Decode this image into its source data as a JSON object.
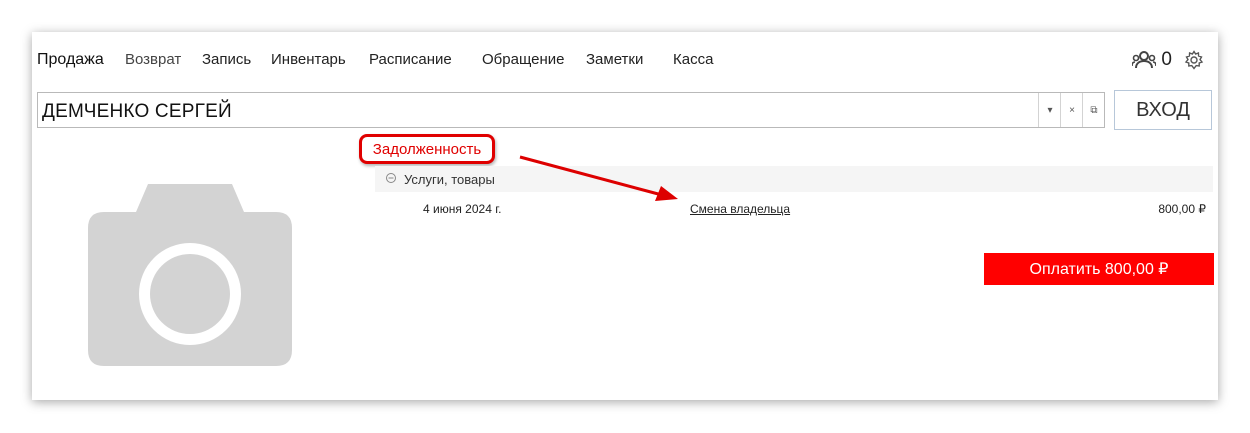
{
  "menu": {
    "items": [
      "Продажа",
      "Возврат",
      "Запись",
      "Инвентарь",
      "Расписание",
      "Обращение",
      "Заметки",
      "Касса"
    ]
  },
  "header": {
    "users_count": "0",
    "users_icon": "users-icon",
    "settings_icon": "gear-icon"
  },
  "client": {
    "name": "ДЕМЧЕНКО СЕРГЕЙ",
    "dropdown_glyph": "▾",
    "clear_glyph": "×",
    "open_glyph": "⧉"
  },
  "login_button": "ВХОД",
  "debt": {
    "label": "Задолженность",
    "group": {
      "label": "Услуги, товары",
      "collapse_glyph": "⊖"
    },
    "items": [
      {
        "date": "4 июня 2024 г.",
        "name": "Смена владельца",
        "amount": "800,00 ₽"
      }
    ]
  },
  "pay_button": "Оплатить 800,00 ₽",
  "colors": {
    "accent": "#ff0000",
    "annotation": "#e00000"
  }
}
